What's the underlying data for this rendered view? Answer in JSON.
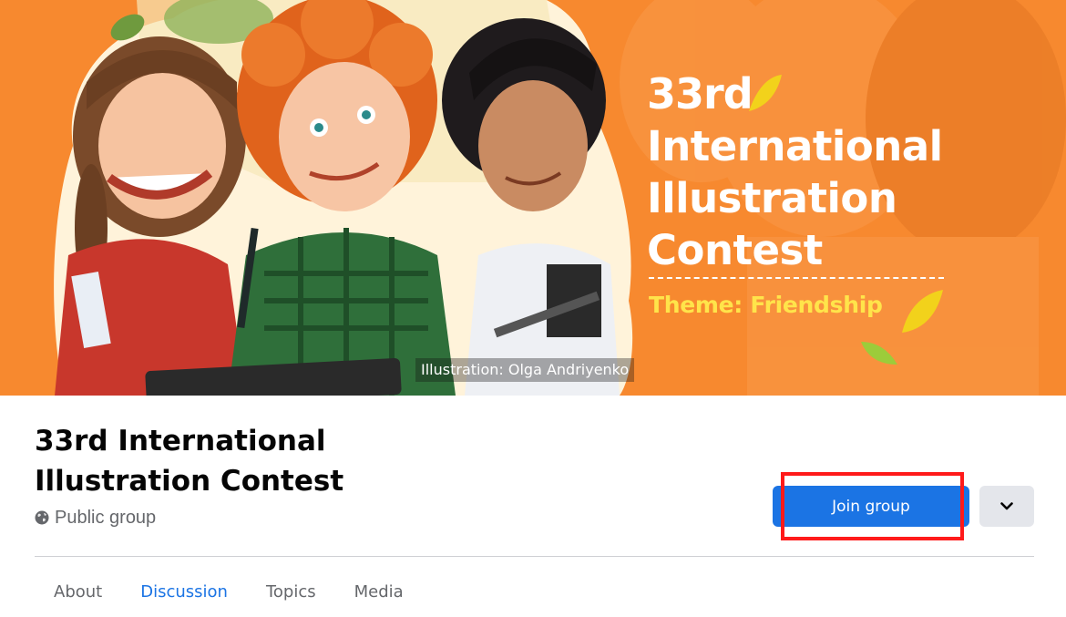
{
  "cover": {
    "edition": "33rd",
    "title_lines": [
      "International",
      "Illustration",
      "Contest"
    ],
    "theme": "Theme: Friendship",
    "credit": "Illustration: Olga Andriyenko",
    "colors": {
      "background": "#f7892f",
      "theme_text": "#ffe44a",
      "leaf": "#9ccc3a",
      "leaf_yellow": "#f2d21b"
    }
  },
  "group": {
    "title": "33rd International Illustration Contest",
    "privacy_icon": "globe-icon",
    "privacy": "Public group"
  },
  "actions": {
    "join_label": "Join group",
    "more_icon": "chevron-down-icon",
    "highlight_color": "#ff1a1a"
  },
  "tabs": [
    {
      "label": "About",
      "active": false
    },
    {
      "label": "Discussion",
      "active": true
    },
    {
      "label": "Topics",
      "active": false
    },
    {
      "label": "Media",
      "active": false
    }
  ],
  "colors": {
    "accent": "#1b74e4",
    "muted_text": "#65676b",
    "title_text": "#050505"
  }
}
